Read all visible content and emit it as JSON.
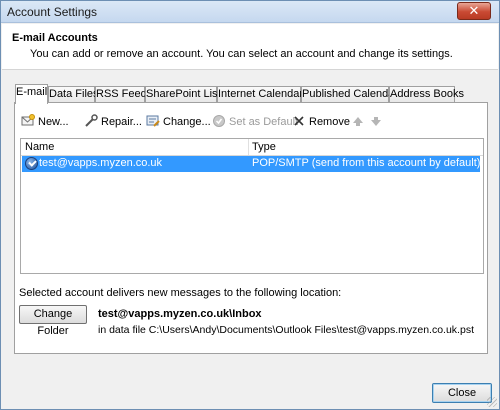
{
  "window": {
    "title": "Account Settings"
  },
  "header": {
    "title": "E-mail Accounts",
    "subtitle": "You can add or remove an account. You can select an account and change its settings."
  },
  "tabs": [
    {
      "label": "E-mail",
      "active": true
    },
    {
      "label": "Data Files"
    },
    {
      "label": "RSS Feeds"
    },
    {
      "label": "SharePoint Lists"
    },
    {
      "label": "Internet Calendars"
    },
    {
      "label": "Published Calendars"
    },
    {
      "label": "Address Books"
    }
  ],
  "toolbar": {
    "new": "New...",
    "repair": "Repair...",
    "change": "Change...",
    "set_default": "Set as Default",
    "remove": "Remove",
    "move_up_icon": "up-arrow",
    "move_down_icon": "down-arrow"
  },
  "list": {
    "columns": {
      "name": "Name",
      "type": "Type"
    },
    "rows": [
      {
        "name": "test@vapps.myzen.co.uk",
        "type": "POP/SMTP (send from this account by default)",
        "selected": true
      }
    ]
  },
  "delivery": {
    "label": "Selected account delivers new messages to the following location:",
    "change_folder": "Change Folder",
    "inbox_path": "test@vapps.myzen.co.uk\\Inbox",
    "data_file": "in data file C:\\Users\\Andy\\Documents\\Outlook Files\\test@vapps.myzen.co.uk.pst"
  },
  "footer": {
    "close": "Close"
  },
  "colors": {
    "selection": "#3399ff",
    "titlebar": "#c5d8ef",
    "close_button": "#c94a33"
  }
}
